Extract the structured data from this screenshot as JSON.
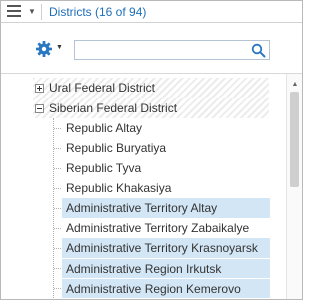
{
  "titlebar": {
    "title": "Districts (16 of 94)",
    "menu_icon": "hamburger-icon",
    "dropdown_icon": "caret-down-icon"
  },
  "toolbar": {
    "settings_icon": "gear-icon",
    "search": {
      "value": "",
      "placeholder": ""
    },
    "search_icon": "magnifier-icon"
  },
  "tree": {
    "groups": [
      {
        "label": "Ural Federal District",
        "expanded": false
      },
      {
        "label": "Siberian Federal District",
        "expanded": true
      }
    ],
    "items": [
      {
        "label": "Republic Altay",
        "selected": false
      },
      {
        "label": "Republic Buryatiya",
        "selected": false
      },
      {
        "label": "Republic Tyva",
        "selected": false
      },
      {
        "label": "Republic Khakasiya",
        "selected": false
      },
      {
        "label": "Administrative Territory Altay",
        "selected": true
      },
      {
        "label": "Administrative Territory Zabaikalye",
        "selected": false
      },
      {
        "label": "Administrative Territory Krasnoyarsk",
        "selected": true
      },
      {
        "label": "Administrative Region Irkutsk",
        "selected": true
      },
      {
        "label": "Administrative Region Kemerovo",
        "selected": true
      }
    ]
  },
  "colors": {
    "accent": "#1e6fb8",
    "selection": "#d3e6f5"
  }
}
